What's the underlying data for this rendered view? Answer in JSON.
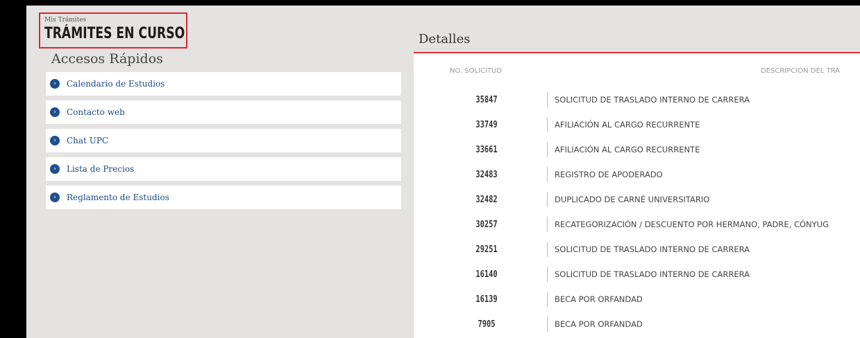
{
  "header": {
    "breadcrumb": "Mis Trámites",
    "title": "TRÁMITES EN CURSO"
  },
  "quick_access": {
    "heading": "Accesos Rápidos",
    "items": [
      {
        "label": "Calendario de Estudios",
        "icon": "chevron-right-circle-icon"
      },
      {
        "label": "Contacto web",
        "icon": "chevron-right-circle-icon"
      },
      {
        "label": "Chat UPC",
        "icon": "chevron-right-circle-icon"
      },
      {
        "label": "Lista de Precios",
        "icon": "chevron-right-circle-icon"
      },
      {
        "label": "Reglamento de Estudios",
        "icon": "chevron-right-circle-icon"
      }
    ]
  },
  "details": {
    "heading": "Detalles",
    "columns": [
      "NO. SOLICITUD",
      "DESCRIPCIÓN DEL TRA"
    ],
    "rows": [
      {
        "number": "35847",
        "description": "SOLICITUD DE TRASLADO INTERNO DE CARRERA"
      },
      {
        "number": "33749",
        "description": "AFILIACIÓN AL CARGO RECURRENTE"
      },
      {
        "number": "33661",
        "description": "AFILIACIÓN AL CARGO RECURRENTE"
      },
      {
        "number": "32483",
        "description": "REGISTRO DE APODERADO"
      },
      {
        "number": "32482",
        "description": "DUPLICADO DE CARNÉ UNIVERSITARIO"
      },
      {
        "number": "30257",
        "description": "RECATEGORIZACIÓN / DESCUENTO POR HERMANO, PADRE, CÓNYUG"
      },
      {
        "number": "29251",
        "description": "SOLICITUD DE TRASLADO INTERNO DE CARRERA"
      },
      {
        "number": "16140",
        "description": "SOLICITUD DE TRASLADO INTERNO DE CARRERA"
      },
      {
        "number": "16139",
        "description": "BECA POR ORFANDAD"
      },
      {
        "number": "7905",
        "description": "BECA POR ORFANDAD"
      }
    ]
  },
  "colors": {
    "highlight_box": "#e0252b",
    "link": "#1a4a84",
    "link_icon": "#1f4f8f",
    "accent_rule": "#d8333a",
    "background": "#e4e3e2"
  }
}
